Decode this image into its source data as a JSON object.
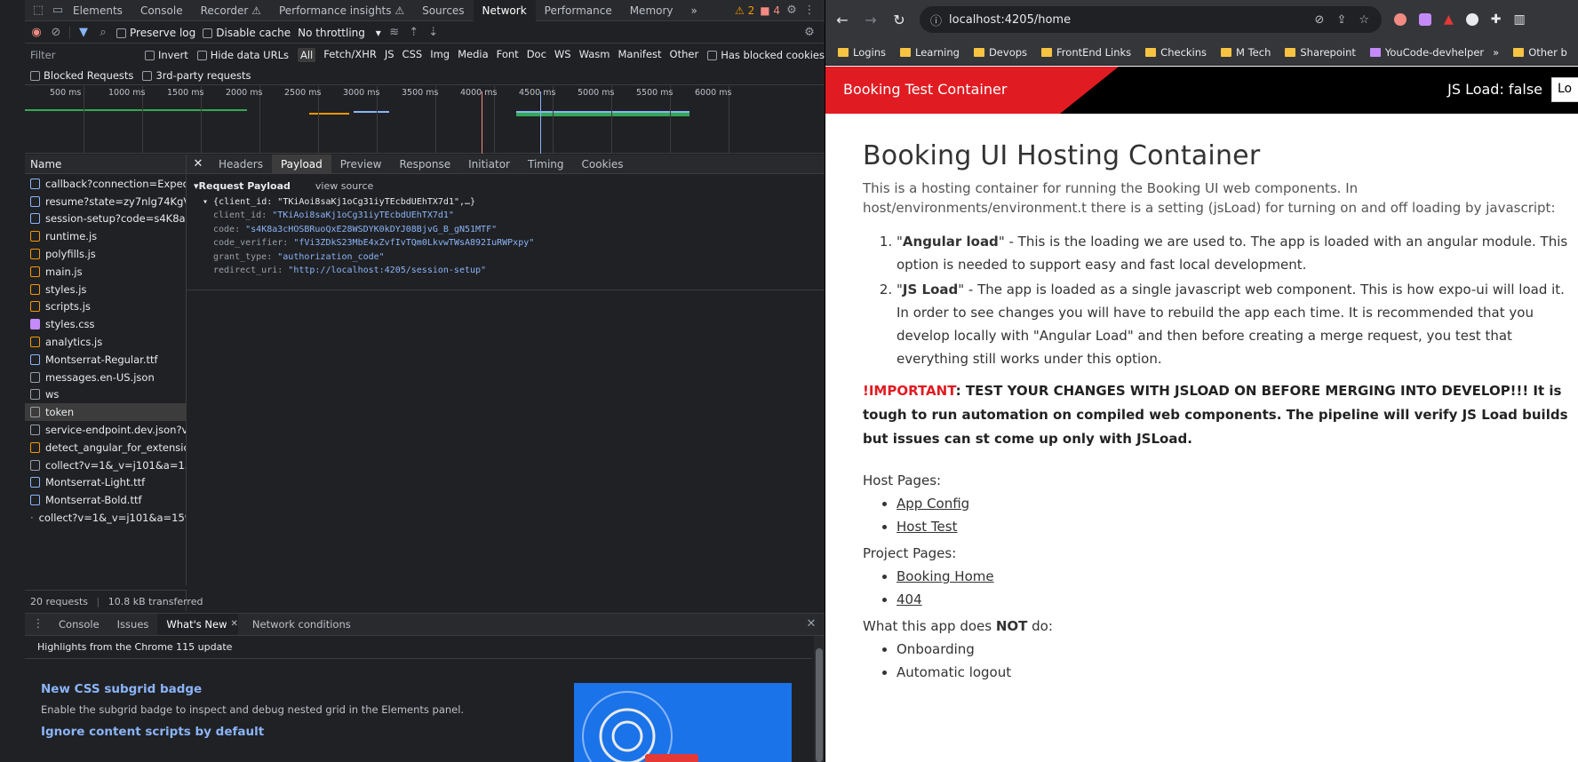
{
  "devtools": {
    "tabs": [
      "Elements",
      "Console",
      "Recorder ⚠",
      "Performance insights ⚠",
      "Sources",
      "Network",
      "Performance",
      "Memory",
      "»"
    ],
    "warn_count": "2",
    "err_count": "4",
    "toolbar": {
      "preserve_log": "Preserve log",
      "disable_cache": "Disable cache",
      "throttling": "No throttling"
    },
    "filter": {
      "placeholder": "Filter",
      "invert": "Invert",
      "hide_data_urls": "Hide data URLs",
      "types": [
        "All",
        "Fetch/XHR",
        "JS",
        "CSS",
        "Img",
        "Media",
        "Font",
        "Doc",
        "WS",
        "Wasm",
        "Manifest",
        "Other"
      ],
      "has_blocked_cookies": "Has blocked cookies",
      "blocked_requests": "Blocked Requests",
      "third_party": "3rd-party requests"
    },
    "timeline_ticks": [
      "500 ms",
      "1000 ms",
      "1500 ms",
      "2000 ms",
      "2500 ms",
      "3000 ms",
      "3500 ms",
      "4000 ms",
      "4500 ms",
      "5000 ms",
      "5500 ms",
      "6000 ms"
    ],
    "name_header": "Name",
    "requests": [
      {
        "name": "callback?connection=Expedit...",
        "type": "doc"
      },
      {
        "name": "resume?state=zy7nlg74KgV...",
        "type": "doc"
      },
      {
        "name": "session-setup?code=s4K8a3c...",
        "type": "doc"
      },
      {
        "name": "runtime.js",
        "type": "js"
      },
      {
        "name": "polyfills.js",
        "type": "js"
      },
      {
        "name": "main.js",
        "type": "js"
      },
      {
        "name": "styles.js",
        "type": "js"
      },
      {
        "name": "scripts.js",
        "type": "js"
      },
      {
        "name": "styles.css",
        "type": "css"
      },
      {
        "name": "analytics.js",
        "type": "js"
      },
      {
        "name": "Montserrat-Regular.ttf",
        "type": "font"
      },
      {
        "name": "messages.en-US.json",
        "type": "ws"
      },
      {
        "name": "ws",
        "type": "ws"
      },
      {
        "name": "token",
        "type": "ws"
      },
      {
        "name": "service-endpoint.dev.json?v=...",
        "type": "ws"
      },
      {
        "name": "detect_angular_for_extension...",
        "type": "js"
      },
      {
        "name": "collect?v=1&_v=j101&a=159...",
        "type": "ws"
      },
      {
        "name": "Montserrat-Light.ttf",
        "type": "font"
      },
      {
        "name": "Montserrat-Bold.ttf",
        "type": "font"
      },
      {
        "name": "collect?v=1&_v=j101&a=159...",
        "type": "dot"
      }
    ],
    "footer": {
      "requests": "20 requests",
      "transferred": "10.8 kB transferred"
    },
    "detail_tabs": [
      "Headers",
      "Payload",
      "Preview",
      "Response",
      "Initiator",
      "Timing",
      "Cookies"
    ],
    "payload": {
      "title": "Request Payload",
      "view_source": "view source",
      "summary": "{client_id: \"TKiAoi8saKj1oCg31iyTEcbdUEhTX7d1\",…}",
      "fields": [
        {
          "key": "client_id",
          "value": "\"TKiAoi8saKj1oCg31iyTEcbdUEhTX7d1\""
        },
        {
          "key": "code",
          "value": "\"s4K8a3cHOSBRuoQxE28WSDYK0kDYJ08BjvG_B_gN51MTF\""
        },
        {
          "key": "code_verifier",
          "value": "\"fVi3ZDkS23MbE4xZvfIvTQm0LkvwTWsA892IuRWPxpy\""
        },
        {
          "key": "grant_type",
          "value": "\"authorization_code\""
        },
        {
          "key": "redirect_uri",
          "value": "\"http://localhost:4205/session-setup\""
        }
      ]
    },
    "drawer_tabs": [
      "Console",
      "Issues",
      "What's New",
      "Network conditions"
    ],
    "whats_new": {
      "highlights": "Highlights from the Chrome 115 update",
      "items": [
        {
          "title": "New CSS subgrid badge",
          "desc": "Enable the subgrid badge to inspect and debug nested grid in the Elements panel."
        },
        {
          "title": "Ignore content scripts by default",
          "desc": ""
        }
      ]
    }
  },
  "browser": {
    "url": "localhost:4205/home",
    "bookmarks": [
      "Logins",
      "Learning",
      "Devops",
      "FrontEnd Links",
      "Checkins",
      "M Tech",
      "Sharepoint",
      "YouCode-devhelper",
      "»",
      "Other b"
    ],
    "app": {
      "title": "Booking Test Container",
      "js_load": "JS Load: false",
      "button": "Lo"
    },
    "page": {
      "heading": "Booking UI Hosting Container",
      "intro": "This is a hosting container for running the Booking UI web components. In host/environments/environment.t there is a setting (jsLoad) for turning on and off loading by javascript:",
      "items": [
        {
          "bold": "Angular load",
          "text": " - This is the loading we are used to. The app is loaded with an angular module. This option is needed to support easy and fast local development."
        },
        {
          "bold": "JS Load",
          "text": " - The app is loaded as a single javascript web component. This is how expo-ui will load it. In order to see changes you will have to rebuild the app each time. It is recommended that you develop locally with \"Angular Load\" and then before creating a merge request, you test that everything still works under this option."
        }
      ],
      "important_label": "!IMPORTANT",
      "important_text": ": TEST YOUR CHANGES WITH JSLOAD ON BEFORE MERGING INTO DEVELOP!!! It is tough to run automation on compiled web components. The pipeline will verify JS Load builds but issues can st come up only with JSLoad.",
      "host_pages_label": "Host Pages:",
      "host_pages": [
        "App Config",
        "Host Test"
      ],
      "project_pages_label": "Project Pages:",
      "project_pages": [
        "Booking Home",
        "404"
      ],
      "not_do_prefix": "What this app does ",
      "not_do_bold": "NOT",
      "not_do_suffix": " do:",
      "not_do": [
        "Onboarding",
        "Automatic logout"
      ]
    }
  }
}
